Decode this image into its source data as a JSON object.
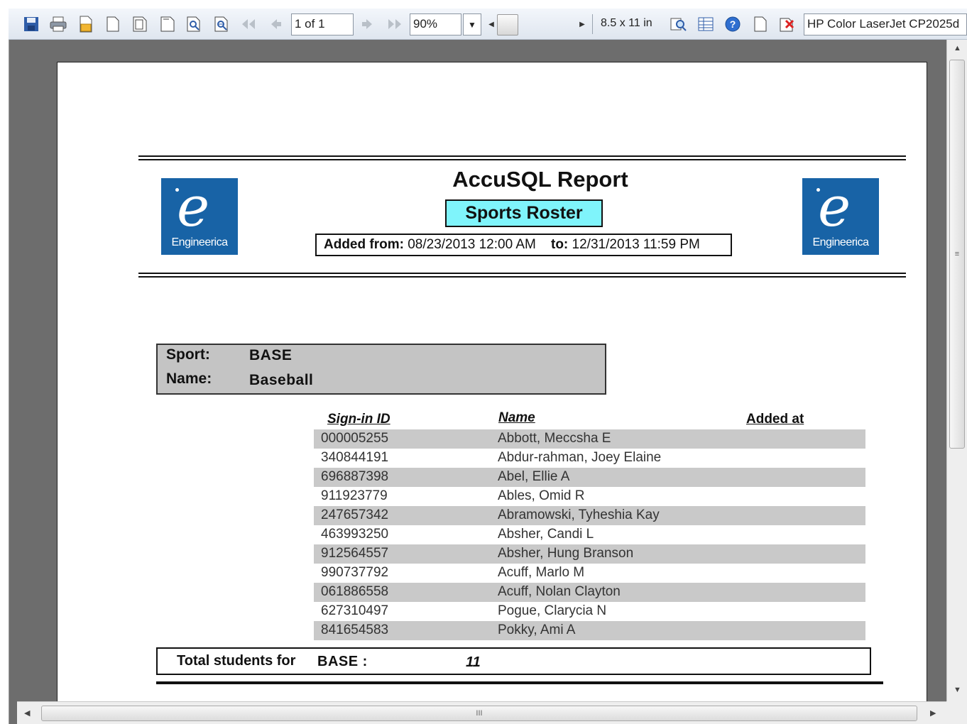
{
  "toolbar": {
    "page_indicator": "1 of 1",
    "zoom": "90%",
    "paper_size": "8.5 x 11 in",
    "printer": "HP Color LaserJet CP2025d"
  },
  "report": {
    "title": "AccuSQL Report",
    "subtitle": "Sports Roster",
    "logo_text": "Engineerica",
    "added_from_label": "Added from:",
    "added_from_value": "08/23/2013 12:00 AM",
    "to_label": "to:",
    "to_value": "12/31/2013 11:59 PM"
  },
  "sport": {
    "sport_label": "Sport:",
    "sport_value": "BASE",
    "name_label": "Name:",
    "name_value": "Baseball"
  },
  "columns": {
    "signin_id": "Sign-in ID",
    "name": "Name",
    "added_at": "Added at"
  },
  "rows": [
    {
      "id": "000005255",
      "name": "Abbott, Meccsha E"
    },
    {
      "id": "340844191",
      "name": "Abdur-rahman, Joey Elaine"
    },
    {
      "id": "696887398",
      "name": "Abel, Ellie A"
    },
    {
      "id": "911923779",
      "name": "Ables, Omid R"
    },
    {
      "id": "247657342",
      "name": "Abramowski, Tyheshia Kay"
    },
    {
      "id": "463993250",
      "name": "Absher, Candi L"
    },
    {
      "id": "912564557",
      "name": "Absher, Hung Branson"
    },
    {
      "id": "990737792",
      "name": "Acuff, Marlo M"
    },
    {
      "id": "061886558",
      "name": "Acuff, Nolan Clayton"
    },
    {
      "id": "627310497",
      "name": "Pogue, Clarycia N"
    },
    {
      "id": "841654583",
      "name": "Pokky, Ami A"
    }
  ],
  "total": {
    "label": "Total students for",
    "code": "BASE :",
    "count": "11"
  },
  "scrollbar": {
    "grip": "III"
  },
  "colors": {
    "logo_blue": "#1863a6",
    "subtitle_bg": "#7ff4fb",
    "row_shade": "#c9c9c9",
    "viewer_bg": "#6d6d6d"
  }
}
